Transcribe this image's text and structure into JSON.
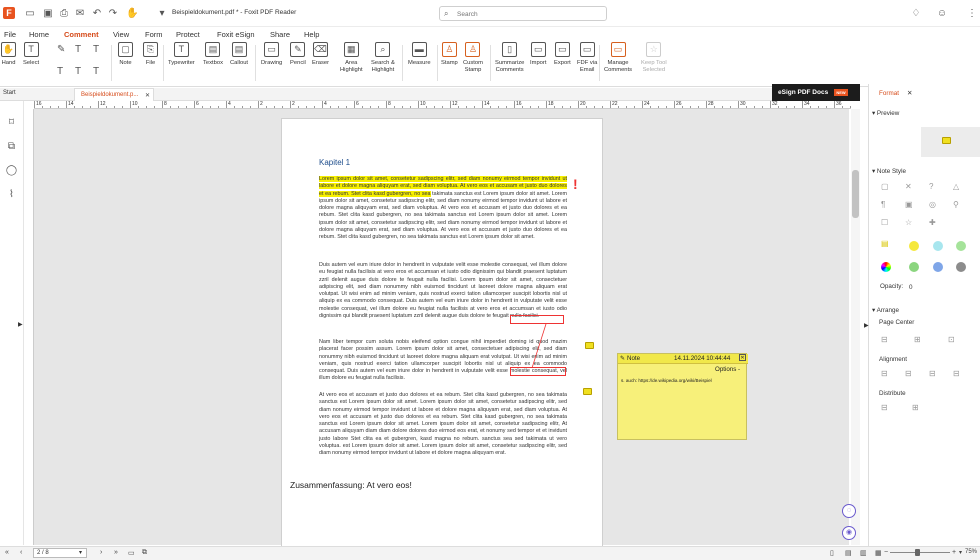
{
  "titlebar": {
    "doc_title": "Beispieldokument.pdf * - Foxit PDF Reader",
    "search_placeholder": "Search"
  },
  "menu": [
    "File",
    "Home",
    "Comment",
    "View",
    "Form",
    "Protect",
    "Foxit eSign",
    "Share",
    "Help"
  ],
  "ribbon": {
    "hand": "Hand",
    "select": "Select",
    "note": "Note",
    "file": "File",
    "typewriter": "Typewriter",
    "textbox": "Textbox",
    "callout": "Callout",
    "drawing": "Drawing",
    "pencil": "Pencil",
    "eraser": "Eraser",
    "area_highlight": "Area\nHighlight",
    "search_highlight": "Search &\nHighlight",
    "measure": "Measure",
    "stamp": "Stamp",
    "custom_stamp": "Custom\nStamp",
    "summarize": "Summarize\nComments",
    "import": "Import",
    "export": "Export",
    "fdf": "FDF via\nEmail",
    "manage": "Manage\nComments",
    "keep": "Keep Tool\nSelected"
  },
  "tabs": {
    "start": "Start",
    "doc": "Beispieldokument.p..."
  },
  "esign": {
    "label": "eSign PDF Docs",
    "badge": "NEW"
  },
  "ruler": [
    "16",
    "14",
    "12",
    "10",
    "8",
    "6",
    "4",
    "2",
    "2",
    "4",
    "6",
    "8",
    "10",
    "12",
    "14",
    "16",
    "18",
    "20",
    "22",
    "24",
    "26",
    "28",
    "30",
    "32",
    "34",
    "36"
  ],
  "document": {
    "chapter": "Kapitel 1",
    "p1_hl": "Lorem ipsum dolor sit amet, consetetur sadipscing elitr, sed diam nonumy eirmod tempor invidunt ut labore et dolore magna aliquyam erat, sed diam voluptua. At vero eos et accusam et justo duo dolores et ea rebum. Stet clita kasd gubergren, no sea",
    "p1_rest": " takimata sanctus est Lorem ipsum dolor sit amet. Lorem ipsum dolor sit amet, consetetur sadipscing elitr, sed diam nonumy eirmod tempor invidunt ut labore et dolore magna aliquyam erat, sed diam voluptua. At vero eos et accusam et justo duo dolores et ea rebum. Stet clita kasd gubergren, no sea takimata sanctus est Lorem ipsum dolor sit amet. Lorem ipsum dolor sit amet, consetetur sadipscing elitr, sed diam nonumy eirmod tempor invidunt ut labore et dolore magna aliquyam erat, sed diam voluptua. At vero eos et accusam et justo duo dolores et ea rebum. Stet clita kasd gubergren, no sea takimata sanctus est Lorem ipsum dolor sit amet.",
    "p2": "Duis autem vel eum iriure dolor in hendrerit in vulputate velit esse molestie consequat, vel illum dolore eu feugiat nulla facilisis at vero eros et accumsan et iusto odio dignissim qui blandit praesent luptatum zzril delenit augue duis dolore te feugait nulla facilisi. Lorem ipsum dolor sit amet, consectetuer adipiscing elit, sed diam nonummy nibh euismod tincidunt ut laoreet dolore magna aliquam erat volutpat. Ut wisi enim ad minim veniam, quis nostrud exerci tation ullamcorper suscipit lobortis nisl ut aliquip ex ea commodo consequat. Duis autem vel eum iriure dolor in hendrerit in vulputate velit esse molestie consequat, vel illum dolore eu feugiat nulla facilisis at vero eros et accumsan et iusto odio dignissim qui blandit praesent luptatum zzril delenit augue duis dolore te feugait nulla facilisi.",
    "p3": "Nam liber tempor cum soluta nobis eleifend option congue nihil imperdiet doming id quod mazim placerat facer possim assum. Lorem ipsum dolor sit amet, consectetuer adipiscing elit, sed diam nonummy nibh euismod tincidunt ut laoreet dolore magna aliquam erat volutpat. Ut wisi enim ad minim veniam, quis nostrud exerci tation ullamcorper suscipit lobortis nisl ut aliquip ex ea commodo consequat. Duis autem vel eum iriure dolor in hendrerit in vulputate velit esse molestie consequat, vel illum dolore eu feugiat nulla facilisis.",
    "p4": "At vero eos et accusam et justo duo dolores et ea rebum. Stet clita kasd gubergren, no sea takimata sanctus est Lorem ipsum dolor sit amet. Lorem ipsum dolor sit amet, consetetur sadipscing elitr, sed diam nonumy eirmod tempor invidunt ut labore et dolore magna aliquyam erat, sed diam voluptua. At vero eos et accusam et justo duo dolores et ea rebum. Stet clita kasd gubergren, no sea takimata sanctus est Lorem ipsum dolor sit amet. Lorem ipsum dolor sit amet, consetetur sadipscing elitr, At accusam aliquyam diam diam dolore dolores duo eirmod eos erat, et nonumy sed tempor et et invidunt justo labore Stet clita ea et gubergren, kasd magna no rebum. sanctus sea sed takimata ut vero voluptua. est Lorem ipsum dolor sit amet. Lorem ipsum dolor sit amet, consetetur sadipscing elitr, sed diam nonumy eirmod tempor invidunt ut labore et dolore magna aliquyam erat.",
    "summary": "Zusammenfassung: At vero eos!"
  },
  "popup": {
    "title": "Note",
    "date": "14.11.2024 10:44:44",
    "options": "Options -",
    "text": "s. auch: https://de.wikipedia.org/wiki/Beispiel"
  },
  "right_panel": {
    "tab": "Format",
    "preview": "Preview",
    "note_style": "Note Style",
    "opacity_label": "Opacity:",
    "opacity_value": "0",
    "arrange": "Arrange",
    "page_center": "Page Center",
    "alignment": "Alignment",
    "distribute": "Distribute"
  },
  "colors": {
    "yellow": "#f5e83c",
    "light_yellow": "#f7f07a",
    "cyan": "#a8e6ee",
    "green": "#8bd57f",
    "blue": "#7fa6e8",
    "gray": "#8c8c8c",
    "accent": "#d64b1a"
  },
  "status": {
    "page": "2 / 8",
    "zoom": "75%"
  }
}
